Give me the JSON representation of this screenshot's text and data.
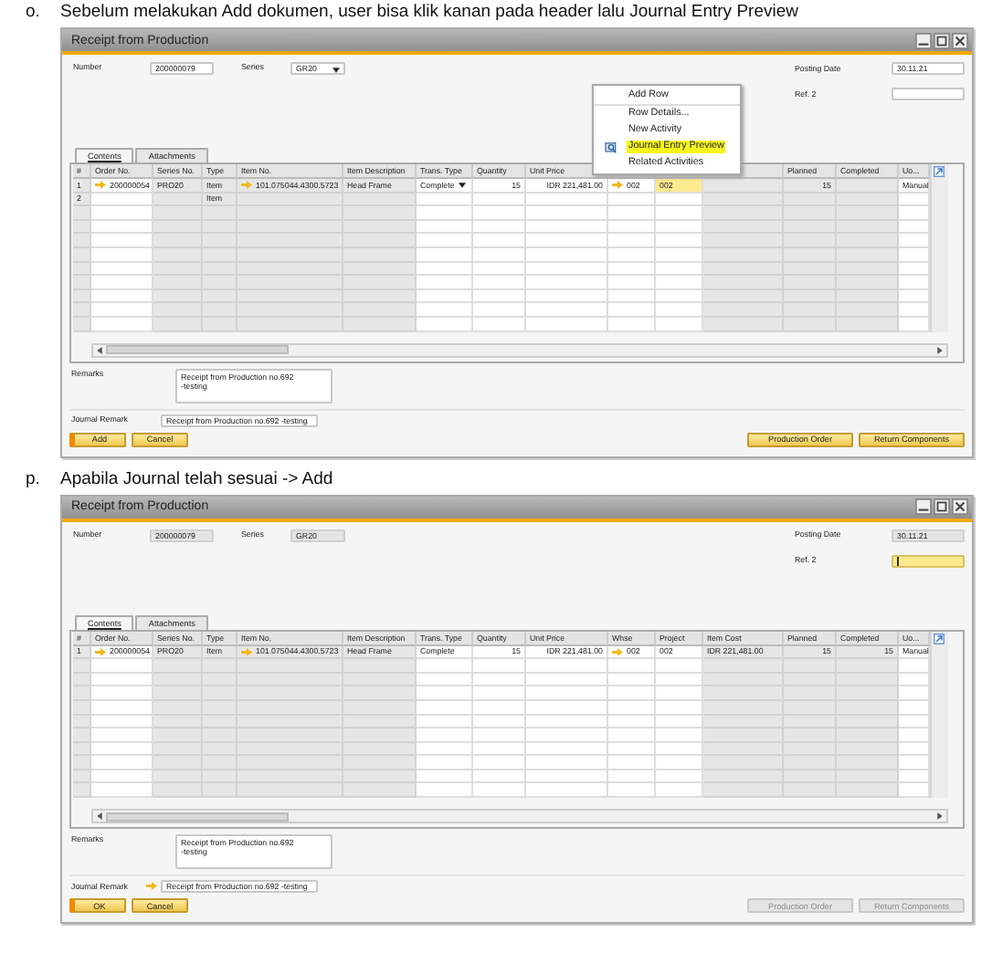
{
  "steps": [
    {
      "marker": "o.",
      "instruction": "Sebelum melakukan Add dokumen, user bisa klik kanan pada header lalu Journal Entry Preview",
      "window": {
        "title": "Receipt from Production",
        "number": {
          "label": "Number",
          "value": "200000079",
          "disabled": false
        },
        "series": {
          "label": "Series",
          "value": "GR20",
          "disabled": false,
          "dropdown": true
        },
        "posting_date": {
          "label": "Posting Date",
          "value": "30.11.21",
          "disabled": false
        },
        "ref2": {
          "label": "Ref. 2",
          "focused": false
        },
        "tabs": [
          {
            "label": "Contents",
            "selected": true
          },
          {
            "label": "Attachments",
            "selected": false
          }
        ],
        "columns": [
          {
            "label": "#"
          },
          {
            "label": "Order No."
          },
          {
            "label": "Series No."
          },
          {
            "label": "Type"
          },
          {
            "label": "Item No."
          },
          {
            "label": "Item Description"
          },
          {
            "label": "Trans. Type"
          },
          {
            "label": "Quantity"
          },
          {
            "label": "Unit Price"
          },
          {},
          {},
          {},
          {
            "label": "Planned"
          },
          {
            "label": "Completed"
          },
          {
            "label": "Uo..."
          }
        ],
        "rows": [
          {
            "cells": [
              {
                "text": "1"
              },
              {
                "text": "200000054",
                "link": true
              },
              {
                "text": "PRO20"
              },
              {
                "text": "Item"
              },
              {
                "text": "101.075044.4300.5723",
                "link": true
              },
              {
                "text": "Head Frame"
              },
              {
                "text": "Complete",
                "dropdown": true
              },
              {
                "text": "15"
              },
              {
                "text": "IDR 221,481.00"
              },
              {
                "text": "002",
                "link": true
              },
              {
                "text": "002",
                "focused": true
              },
              {},
              {
                "text": "15"
              },
              {},
              {
                "text": "Manual"
              }
            ]
          },
          {
            "cells": [
              {
                "text": "2"
              },
              {},
              {},
              {
                "text": "Item"
              },
              {},
              {},
              {},
              {},
              {},
              {},
              {},
              {},
              {},
              {},
              {}
            ]
          }
        ],
        "remarks": {
          "label": "Remarks",
          "value": "Receipt from Production no.692\n-testing"
        },
        "journal_remark": {
          "label": "Journal Remark",
          "value": "Receipt from Production no.692 -testing",
          "link": false
        },
        "left_buttons": [
          {
            "label": "Add",
            "disabled": false,
            "primary": true
          },
          {
            "label": "Cancel",
            "disabled": false,
            "primary": false
          }
        ],
        "right_buttons": [
          {
            "label": "Production Order",
            "disabled": false
          },
          {
            "label": "Return Components",
            "disabled": false
          }
        ],
        "context_menu": [
          {
            "label": "Add Row",
            "highlighted": false
          },
          {
            "label": "Row Details...",
            "highlighted": false
          },
          {
            "label": "New Activity",
            "highlighted": false
          },
          {
            "label": "Journal Entry Preview",
            "highlighted": true,
            "icon": true
          },
          {
            "label": "Related Activities",
            "highlighted": false
          }
        ]
      }
    },
    {
      "marker": "p.",
      "instruction": "Apabila Journal telah sesuai -> Add",
      "window": {
        "title": "Receipt from Production",
        "number": {
          "label": "Number",
          "value": "200000079",
          "disabled": true
        },
        "series": {
          "label": "Series",
          "value": "GR20",
          "disabled": true,
          "dropdown": false
        },
        "posting_date": {
          "label": "Posting Date",
          "value": "30.11.21",
          "disabled": true
        },
        "ref2": {
          "label": "Ref. 2",
          "focused": true
        },
        "tabs": [
          {
            "label": "Contents",
            "selected": true
          },
          {
            "label": "Attachments",
            "selected": false
          }
        ],
        "columns": [
          {
            "label": "#"
          },
          {
            "label": "Order No."
          },
          {
            "label": "Series No."
          },
          {
            "label": "Type"
          },
          {
            "label": "Item No."
          },
          {
            "label": "Item Description"
          },
          {
            "label": "Trans. Type"
          },
          {
            "label": "Quantity"
          },
          {
            "label": "Unit Price"
          },
          {
            "label": "Whse"
          },
          {
            "label": "Project"
          },
          {
            "label": "Item Cost"
          },
          {
            "label": "Planned"
          },
          {
            "label": "Completed"
          },
          {
            "label": "Uo..."
          }
        ],
        "rows": [
          {
            "cells": [
              {
                "text": "1"
              },
              {
                "text": "200000054",
                "link": true
              },
              {
                "text": "PRO20"
              },
              {
                "text": "Item"
              },
              {
                "text": "101.075044.4300.5723",
                "link": true
              },
              {
                "text": "Head Frame"
              },
              {
                "text": "Complete",
                "dropdown": false
              },
              {
                "text": "15"
              },
              {
                "text": "IDR 221,481.00"
              },
              {
                "text": "002",
                "link": true
              },
              {
                "text": "002"
              },
              {
                "text": "IDR 221,481.00"
              },
              {
                "text": "15"
              },
              {
                "text": "15"
              },
              {
                "text": "Manual"
              }
            ]
          }
        ],
        "remarks": {
          "label": "Remarks",
          "value": "Receipt from Production no.692\n-testing"
        },
        "journal_remark": {
          "label": "Journal Remark",
          "value": "Receipt from Production no.692 -testing",
          "link": true
        },
        "left_buttons": [
          {
            "label": "OK",
            "disabled": false,
            "primary": true
          },
          {
            "label": "Cancel",
            "disabled": false,
            "primary": false
          }
        ],
        "right_buttons": [
          {
            "label": "Production Order",
            "disabled": true
          },
          {
            "label": "Return Components",
            "disabled": true
          }
        ]
      }
    }
  ]
}
